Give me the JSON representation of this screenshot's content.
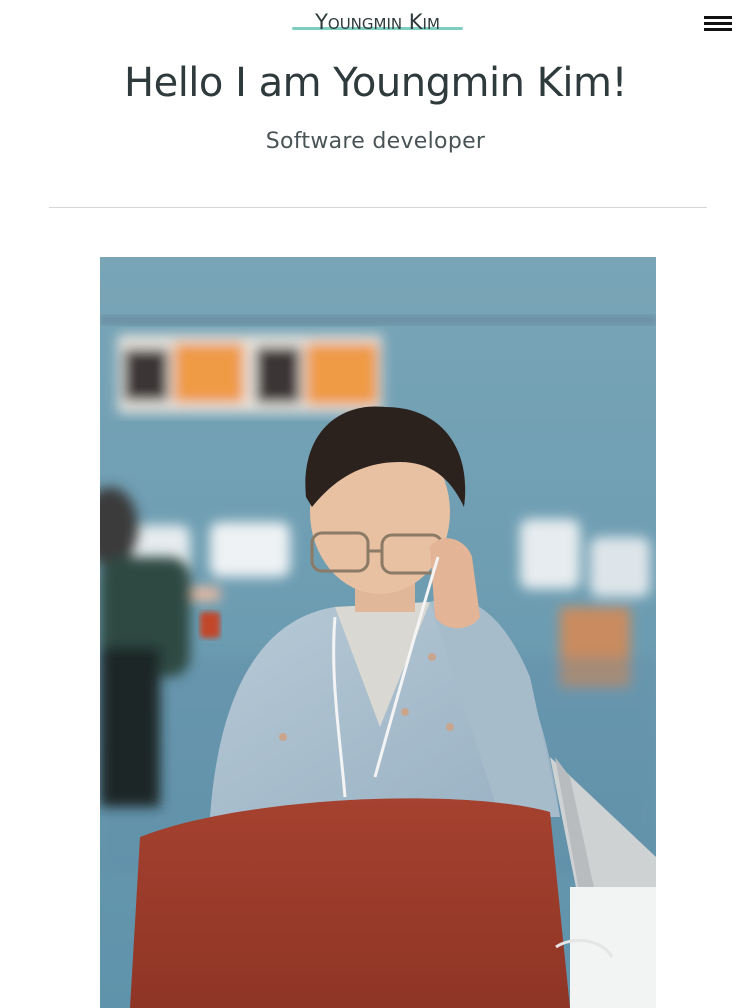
{
  "header": {
    "site_title": "Youngmin Kim",
    "menu_icon": "hamburger-menu-icon"
  },
  "hero": {
    "heading": "Hello I am Youngmin Kim!",
    "subtitle": "Software developer"
  },
  "photo": {
    "subject": "person"
  },
  "colors": {
    "accent": "#7fcfc0",
    "text": "#2f3a3c",
    "divider": "#d6d6d6"
  }
}
